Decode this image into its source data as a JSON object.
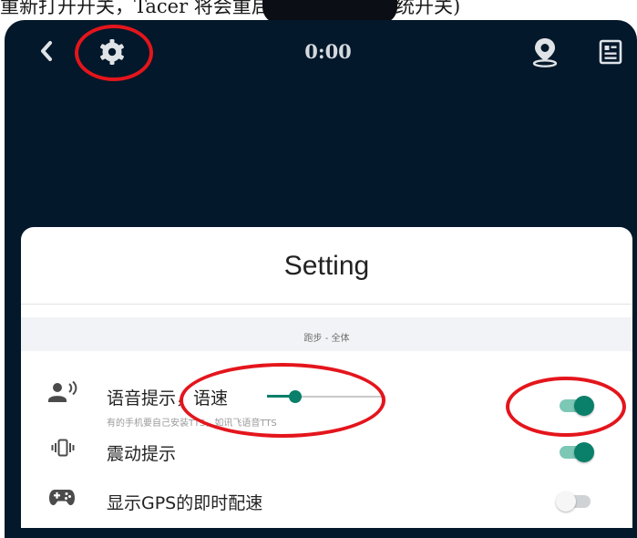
{
  "caption": {
    "text": "重新打开开关，Tacer 将会重启语音。(iOS 系统开关)"
  },
  "header": {
    "back_icon": "chevron-left-icon",
    "settings_icon": "gear-icon",
    "timer": "0:00",
    "location_icon": "location-pin-icon",
    "report_icon": "report-icon"
  },
  "sheet": {
    "title": "Setting",
    "section_label": "跑步 - 全体",
    "rows": [
      {
        "icon": "voice-icon",
        "label": "语音提示，语速",
        "sublabel": "有的手机要自己安装TTS，如讯飞语音TTS",
        "slider_value": 0.24,
        "toggle_on": true
      },
      {
        "icon": "vibration-icon",
        "label": "震动提示",
        "toggle_on": true
      },
      {
        "icon": "gamepad-icon",
        "label": "显示GPS的即时配速",
        "toggle_on": false
      }
    ]
  },
  "colors": {
    "background": "#03182a",
    "accent": "#0a7f6a",
    "annotation": "#e4151c"
  }
}
